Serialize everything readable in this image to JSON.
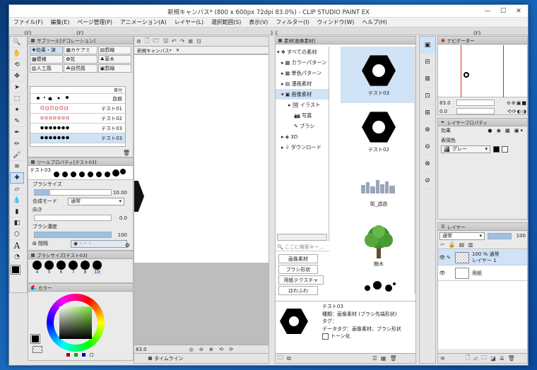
{
  "window": {
    "title": "新規キャンバス* (800 x 600px 72dpi 83.0%) - CLIP STUDIO PAINT EX",
    "min": "—",
    "max": "☐",
    "close": "✕"
  },
  "menu": [
    "ファイル(F)",
    "編集(E)",
    "ページ管理(P)",
    "アニメーション(A)",
    "レイヤー(L)",
    "選択範囲(S)",
    "表示(V)",
    "フィルター(I)",
    "ウィンドウ(W)",
    "ヘルプ(H)"
  ],
  "collapse": {
    "left": "《F》",
    "right": "《F》",
    "mid": "》《"
  },
  "subtool": {
    "tab": "サブツール[デコレーション]",
    "buttons": [
      "効果・演",
      "カケアミ",
      "罫線",
      "模様",
      "花",
      "草木",
      "人工風",
      "自然風",
      "罫線"
    ],
    "list_header": "首付",
    "brushes": [
      "血痕",
      "テスト01",
      "テスト02",
      "テスト03",
      "テスト03"
    ]
  },
  "toolprop": {
    "tab": "ツールプロパティ[テスト03]",
    "brush_name": "テスト03",
    "size_label": "ブラシサイズ",
    "size_value": "10.00",
    "blend_label": "合成モード",
    "blend_value": "通常",
    "dir_label": "向き",
    "dir_value": "0.0",
    "density_label": "ブラシ濃度",
    "density_value": "100",
    "interval_label": "間隔"
  },
  "brushsize": {
    "tab": "ブラシサイズ[テスト03]",
    "sizes": [
      "4",
      "5",
      "6",
      "7",
      "8",
      "10"
    ]
  },
  "color": {
    "tab": "カラー"
  },
  "canvas": {
    "tab": "新規キャンバス*",
    "zoom": "83.0",
    "tl_tab": "タイムライン"
  },
  "material": {
    "tab": "素材[画像素材]",
    "tree": [
      "すべての素材",
      "カラーパターン",
      "単色パターン",
      "漫画素材",
      "画像素材",
      "イラスト",
      "写真",
      "ブラシ",
      "3D",
      "ダウンロード"
    ],
    "search_placeholder": "ここに検索キー...",
    "tags": [
      "画像素材",
      "ブラシ形状",
      "用紙テクスチャ",
      "ほわふわ"
    ],
    "items": [
      "テスト03",
      "テスト02",
      "街_透過",
      "樹木"
    ],
    "detail": {
      "name": "テスト03",
      "kind": "種類：画像素材 (ブラシ先端形状)",
      "tag": "タグ：",
      "datatag": "データタグ：画像素材，ブラシ形状",
      "tone": "トーン化"
    }
  },
  "navigator": {
    "tab": "ナビゲーター",
    "zoom": "83.0",
    "angle": "0.0"
  },
  "layerprop": {
    "tab": "レイヤープロパティ",
    "effect": "効果",
    "color_label": "表現色",
    "color_value": "グレー"
  },
  "layers": {
    "tab": "レイヤー",
    "blend": "通常",
    "opacity": "100",
    "items": [
      {
        "pct": "100 % 通常",
        "name": "レイヤー 1"
      },
      {
        "pct": "",
        "name": "用紙"
      }
    ]
  }
}
